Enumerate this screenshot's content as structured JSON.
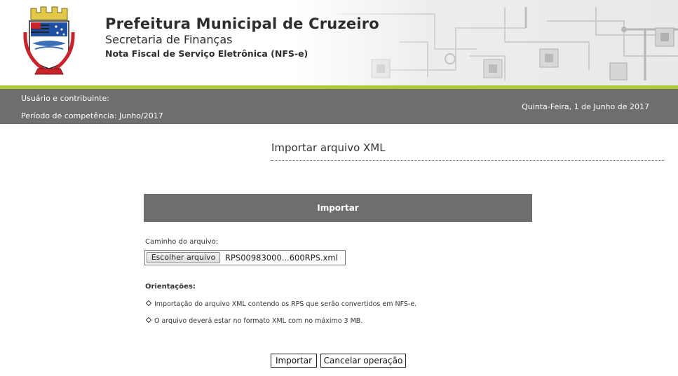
{
  "header": {
    "title": "Prefeitura Municipal de Cruzeiro",
    "subtitle": "Secretaria de Finanças",
    "system": "Nota Fiscal de Serviço Eletrônica (NFS-e)",
    "crest_icon": "city-crest-icon",
    "accent_color": "#a8cc32"
  },
  "infobar": {
    "user_label": "Usuário e contribuinte:",
    "period_label": "Período de competência: Junho/2017",
    "date": "Quinta-Feira, 1 de Junho de 2017",
    "background": "#6e6e6e"
  },
  "page": {
    "title": "Importar arquivo XML"
  },
  "panel": {
    "heading": "Importar",
    "path_label": "Caminho do arquivo:",
    "file_button": "Escolher arquivo",
    "file_name": "RPS00983000...600RPS.xml",
    "orientations_title": "Orientações:",
    "orientations": [
      "Importação do arquivo XML contendo os RPS que serão convertidos em NFS-e.",
      "O arquivo deverá estar no formato XML com no máximo 3 MB."
    ]
  },
  "actions": {
    "import_label": "Importar",
    "cancel_label": "Cancelar operação"
  }
}
